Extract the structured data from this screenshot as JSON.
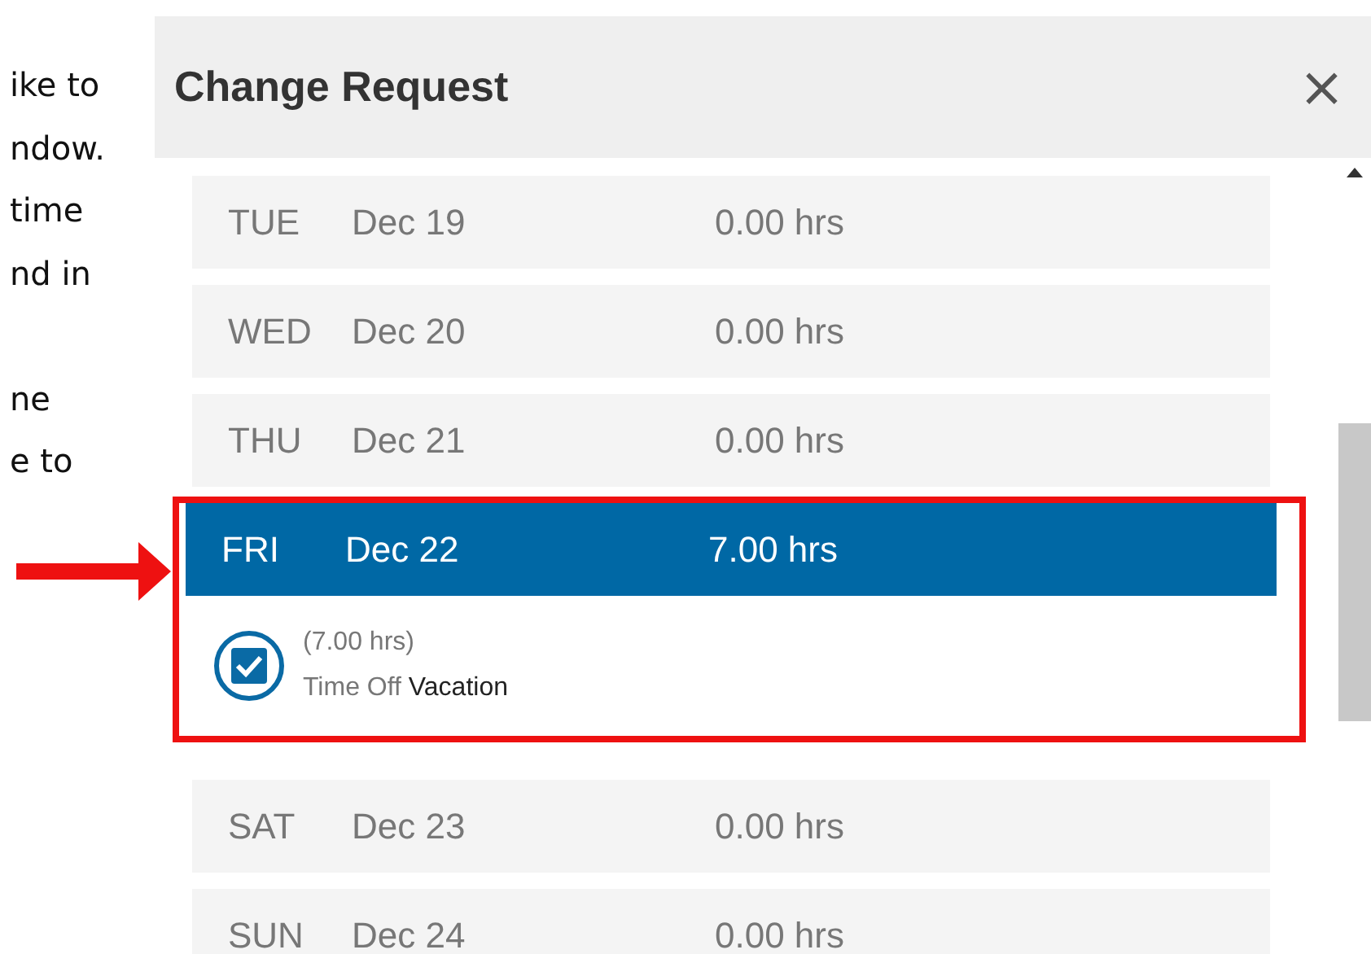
{
  "side_text": {
    "paragraphs": [
      [
        "ike to",
        "ndow.",
        "time",
        "nd in"
      ],
      [
        "ne",
        "e to"
      ]
    ]
  },
  "dialog": {
    "title": "Change Request",
    "close": "×",
    "days": [
      {
        "day": "TUE",
        "date": "Dec 19",
        "hours": "0.00 hrs",
        "selected": false,
        "highlighted": false
      },
      {
        "day": "WED",
        "date": "Dec 20",
        "hours": "0.00 hrs",
        "selected": false,
        "highlighted": false
      },
      {
        "day": "THU",
        "date": "Dec 21",
        "hours": "0.00 hrs",
        "selected": false,
        "highlighted": false
      },
      {
        "day": "FRI",
        "date": "Dec 22",
        "hours": "7.00 hrs",
        "selected": true,
        "highlighted": true,
        "entries": [
          {
            "hours": "(7.00 hrs)",
            "type": "Time Off",
            "code": "Vacation",
            "checked": true
          }
        ]
      },
      {
        "day": "SAT",
        "date": "Dec 23",
        "hours": "0.00 hrs",
        "selected": false,
        "highlighted": false
      },
      {
        "day": "SUN",
        "date": "Dec 24",
        "hours": "0.00 hrs",
        "selected": false,
        "highlighted": false
      }
    ]
  }
}
